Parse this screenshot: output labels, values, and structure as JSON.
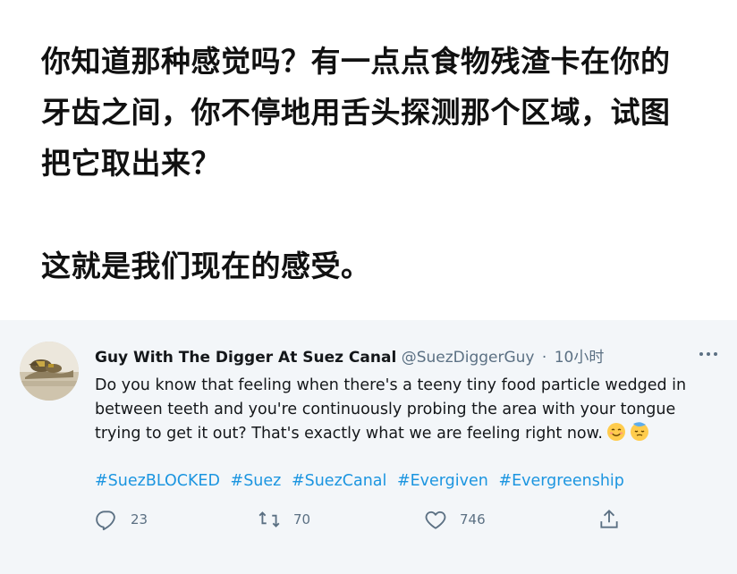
{
  "caption": {
    "paragraph1": [
      "你知道那种感觉吗？有一点点食物残渣卡在你的",
      "牙齿之间，你不停地用舌头探测那个区域，试图",
      "把它取出来？"
    ],
    "paragraph2": "这就是我们现在的感受。"
  },
  "tweet": {
    "display_name": "Guy With The Digger At Suez Canal",
    "handle": "@SuezDiggerGuy",
    "separator": "·",
    "time": "10小时",
    "avatar_icon": "excavator-photo",
    "more_icon": "more-horizontal-icon",
    "text_lines": [
      "Do you know that feeling when there's a teeny tiny food particle wedged in",
      "between teeth and you're continuously probing the area with your tongue",
      "trying to get it out? That's exactly what we are feeling right now."
    ],
    "emojis": [
      "smiling-face-icon",
      "sleeping-face-icon"
    ],
    "hashtags": [
      "#SuezBLOCKED",
      "#Suez",
      "#SuezCanal",
      "#Evergiven",
      "#Evergreenship"
    ],
    "actions": {
      "reply": {
        "icon": "reply-icon",
        "count": "23"
      },
      "retweet": {
        "icon": "retweet-icon",
        "count": "70"
      },
      "like": {
        "icon": "heart-icon",
        "count": "746"
      },
      "share": {
        "icon": "share-icon"
      }
    },
    "colors": {
      "link": "#1b95e0",
      "muted": "#5b7083",
      "background": "#f3f6f9"
    }
  }
}
